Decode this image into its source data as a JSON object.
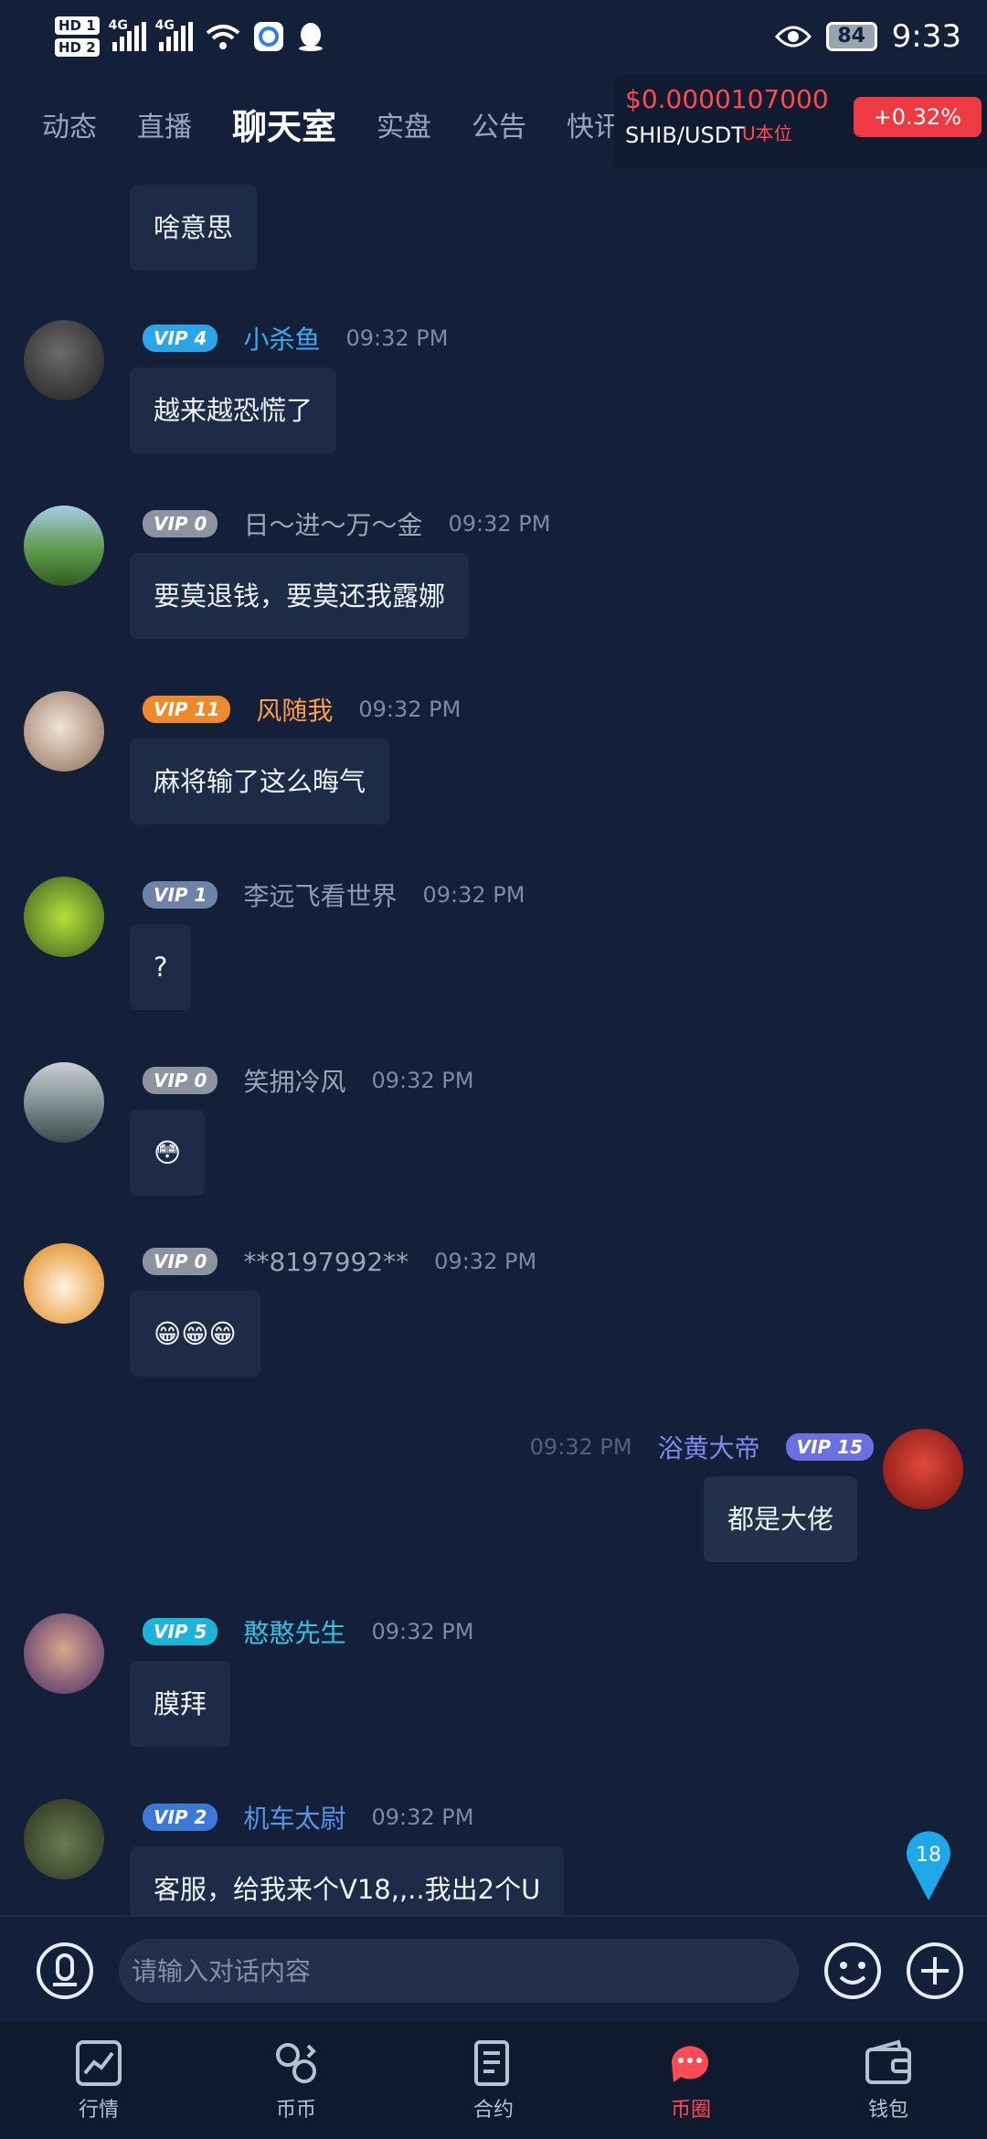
{
  "status_bar": {
    "hd1": "HD 1",
    "hd2": "HD 2",
    "net1": "4G",
    "net2": "4G",
    "battery": "84",
    "time": "9:33"
  },
  "header": {
    "tabs": [
      {
        "label": "动态"
      },
      {
        "label": "直播"
      },
      {
        "label": "聊天室",
        "active": true
      },
      {
        "label": "实盘"
      },
      {
        "label": "公告"
      },
      {
        "label": "快讯"
      }
    ],
    "ticker": {
      "price": "$0.0000107000",
      "pair": "SHIB/USDT",
      "unit": "U本位",
      "change": "+0.32%"
    }
  },
  "messages": [
    {
      "text": "啥意思",
      "partial": true
    },
    {
      "vip": "VIP 4",
      "vip_color": "#2aa6e8",
      "name": "小杀鱼",
      "name_color": "#3da9ef",
      "time": "09:32 PM",
      "text": "越来越恐慌了",
      "avatar_color": "#2a2a2a"
    },
    {
      "vip": "VIP 0",
      "vip_color": "#8d949f",
      "name": "日～进～万～金",
      "name_color": "#9aa5b8",
      "time": "09:32 PM",
      "text": "要莫退钱，要莫还我露娜",
      "avatar_color": "#4c8a3a"
    },
    {
      "vip": "VIP 11",
      "vip_color": "#f0892a",
      "name": "风随我",
      "name_color": "#ff9a45",
      "time": "09:32 PM",
      "text": "麻将输了这么晦气",
      "avatar_color": "#c9b3a4"
    },
    {
      "vip": "VIP 1",
      "vip_color": "#6f82a8",
      "name": "李远飞看世界",
      "name_color": "#8e9bb5",
      "time": "09:32 PM",
      "text": "?",
      "avatar_color": "#8cc43a"
    },
    {
      "vip": "VIP 0",
      "vip_color": "#8d949f",
      "name": "笑拥冷风",
      "name_color": "#9aa5b8",
      "time": "09:32 PM",
      "text": "😳",
      "avatar_color": "#7f8b8f"
    },
    {
      "vip": "VIP 0",
      "vip_color": "#8d949f",
      "name": "**8197992**",
      "name_color": "#9aa5b8",
      "time": "09:32 PM",
      "text": "😁😁😁",
      "avatar_color": "#e8a44a"
    },
    {
      "vip": "VIP 15",
      "vip_color": "#6b6fe0",
      "name": "浴黄大帝",
      "name_color": "#7f8af0",
      "time": "09:32 PM",
      "text": "都是大佬",
      "avatar_color": "#c0282a",
      "self": true
    },
    {
      "vip": "VIP 5",
      "vip_color": "#1db4d8",
      "name": "憨憨先生",
      "name_color": "#2ec5e6",
      "time": "09:32 PM",
      "text": "膜拜",
      "avatar_color": "#5a3a7a"
    },
    {
      "vip": "VIP 2",
      "vip_color": "#3b78d8",
      "name": "机车太尉",
      "name_color": "#5d92e6",
      "time": "09:32 PM",
      "text": "客服，给我来个V18,,..我出2个U",
      "avatar_color": "#3d4a2f"
    }
  ],
  "float_badge": "18",
  "input": {
    "placeholder": "请输入对话内容"
  },
  "bottom_nav": [
    {
      "label": "行情",
      "icon": "chart-icon"
    },
    {
      "label": "币币",
      "icon": "exchange-icon"
    },
    {
      "label": "合约",
      "icon": "contract-icon"
    },
    {
      "label": "币圈",
      "icon": "chat-bubbles-icon",
      "active": true
    },
    {
      "label": "钱包",
      "icon": "wallet-icon"
    }
  ],
  "colors": {
    "background": "#14203a",
    "bubble": "#1d2b47",
    "accent_red": "#ff4b55",
    "badge_blue": "#1fa8e8"
  }
}
